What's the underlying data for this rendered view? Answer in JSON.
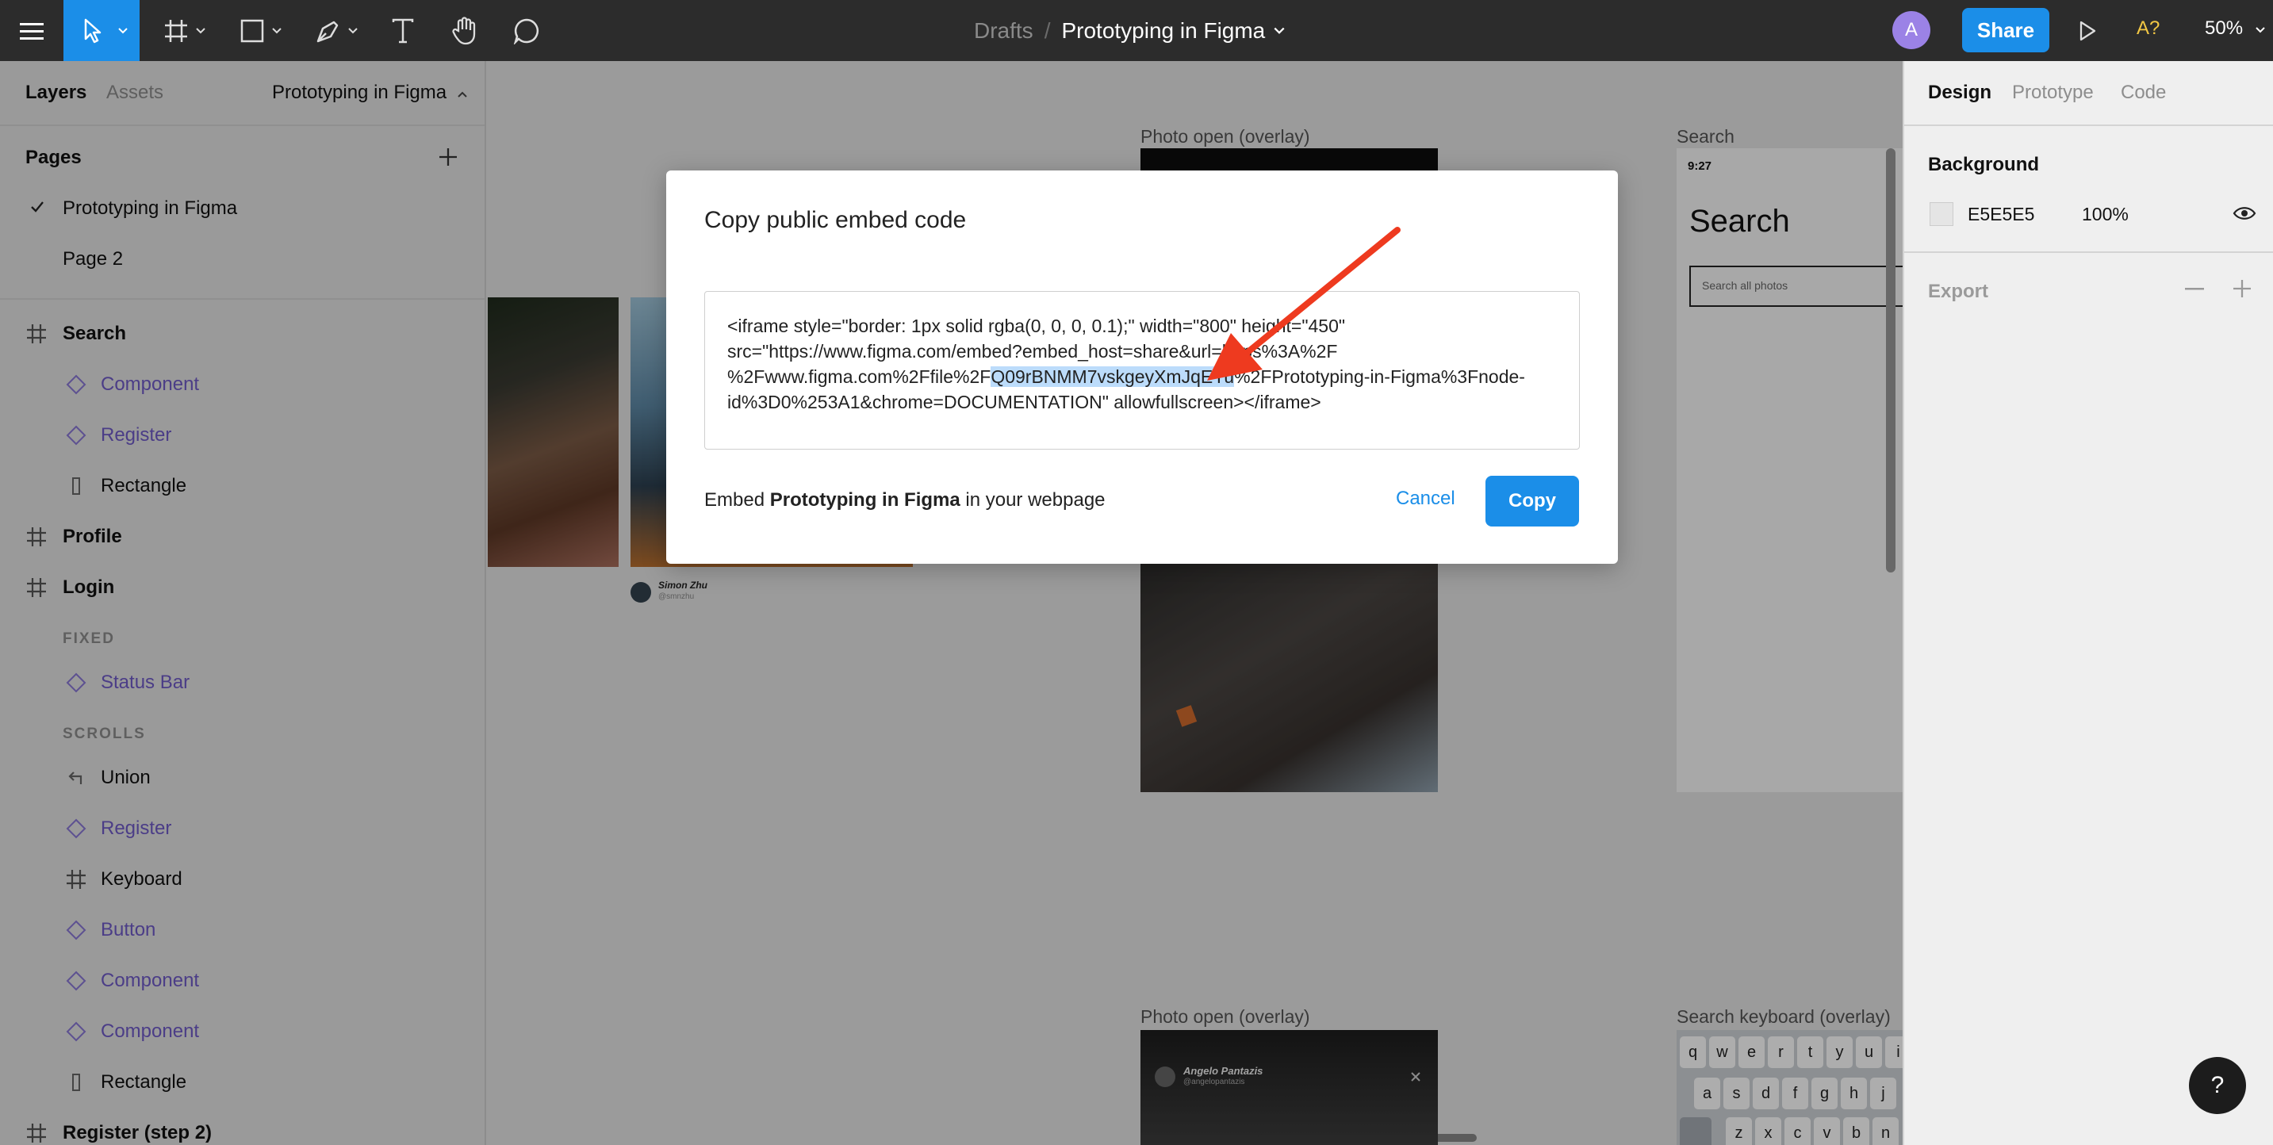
{
  "toolbar": {
    "breadcrumb_drafts": "Drafts",
    "breadcrumb_sep": "/",
    "file_name": "Prototyping in Figma",
    "avatar_letter": "A",
    "share_label": "Share",
    "a11y_label": "A?",
    "zoom_label": "50%",
    "icons": [
      "menu-icon",
      "move-tool-icon",
      "frame-tool-icon",
      "shape-tool-icon",
      "pen-tool-icon",
      "text-tool-icon",
      "hand-tool-icon",
      "comment-tool-icon",
      "present-play-icon"
    ]
  },
  "left_panel": {
    "tabs": {
      "layers": "Layers",
      "assets": "Assets"
    },
    "page_switcher": "Prototyping in Figma",
    "pages_header": "Pages",
    "pages": [
      {
        "label": "Prototyping in Figma",
        "active": true
      },
      {
        "label": "Page 2",
        "active": false
      }
    ],
    "layers": [
      {
        "label": "Search",
        "kind": "frame",
        "indent": 0,
        "bold": true
      },
      {
        "label": "Component",
        "kind": "component",
        "indent": 1
      },
      {
        "label": "Register",
        "kind": "component",
        "indent": 1
      },
      {
        "label": "Rectangle",
        "kind": "rect",
        "indent": 1
      },
      {
        "label": "Profile",
        "kind": "frame",
        "indent": 0,
        "bold": true
      },
      {
        "label": "Login",
        "kind": "frame",
        "indent": 0,
        "bold": true
      },
      {
        "label": "FIXED",
        "kind": "section",
        "indent": 1
      },
      {
        "label": "Status Bar",
        "kind": "component",
        "indent": 1
      },
      {
        "label": "SCROLLS",
        "kind": "section",
        "indent": 1
      },
      {
        "label": "Union",
        "kind": "union",
        "indent": 1
      },
      {
        "label": "Register",
        "kind": "component",
        "indent": 1
      },
      {
        "label": "Keyboard",
        "kind": "frame",
        "indent": 1
      },
      {
        "label": "Button",
        "kind": "component",
        "indent": 1
      },
      {
        "label": "Component",
        "kind": "component",
        "indent": 1
      },
      {
        "label": "Component",
        "kind": "component",
        "indent": 1
      },
      {
        "label": "Rectangle",
        "kind": "rect",
        "indent": 1
      },
      {
        "label": "Register (step 2)",
        "kind": "frame",
        "indent": 0,
        "bold": true
      }
    ]
  },
  "canvas": {
    "frame_labels": {
      "photo_open": "Photo open (overlay)",
      "search": "Search",
      "photo_open_2": "Photo open (overlay)",
      "search_keyboard": "Search keyboard (overlay)"
    },
    "search_frame": {
      "time": "9:27",
      "title": "Search",
      "placeholder": "Search all photos"
    },
    "credit_1": {
      "name": "Simon Zhu",
      "handle": "@smnzhu"
    },
    "credit_2": {
      "name": "Angelo Pantazis",
      "handle": "@angelopantazis"
    },
    "keyboard_row1": [
      "q",
      "w",
      "e",
      "r",
      "t",
      "y",
      "u",
      "i"
    ],
    "keyboard_row2": [
      "a",
      "s",
      "d",
      "f",
      "g",
      "h",
      "j"
    ],
    "keyboard_row3": [
      "z",
      "x",
      "c",
      "v",
      "b",
      "n"
    ]
  },
  "right_panel": {
    "tabs": {
      "design": "Design",
      "prototype": "Prototype",
      "code": "Code"
    },
    "background_label": "Background",
    "background_color": "E5E5E5",
    "background_opacity": "100%",
    "export_label": "Export"
  },
  "modal": {
    "title": "Copy public embed code",
    "code": {
      "line1": "<iframe style=\"border: 1px solid rgba(0, 0, 0, 0.1);\" width=\"800\" height=\"450\"",
      "line2": "src=\"https://www.figma.com/embed?embed_host=share&url=https%3A%2F",
      "line3_pre": "%2Fwww.figma.com%2Ffile%2F",
      "line3_hl": "Q09rBNMM7vskgeyXmJqEYu",
      "line3_post": "%2FPrototyping-in-Figma%3Fnode-",
      "line4": "id%3D0%253A1&chrome=DOCUMENTATION\" allowfullscreen></iframe>"
    },
    "footer_pre": "Embed ",
    "footer_bold": "Prototyping in Figma",
    "footer_post": " in your webpage",
    "cancel_label": "Cancel",
    "copy_label": "Copy"
  },
  "help_label": "?",
  "colors": {
    "accent": "#1b8ee8",
    "component": "#6f5ac8",
    "arrow": "#ee3a1f",
    "highlight": "#bcdcfb"
  }
}
